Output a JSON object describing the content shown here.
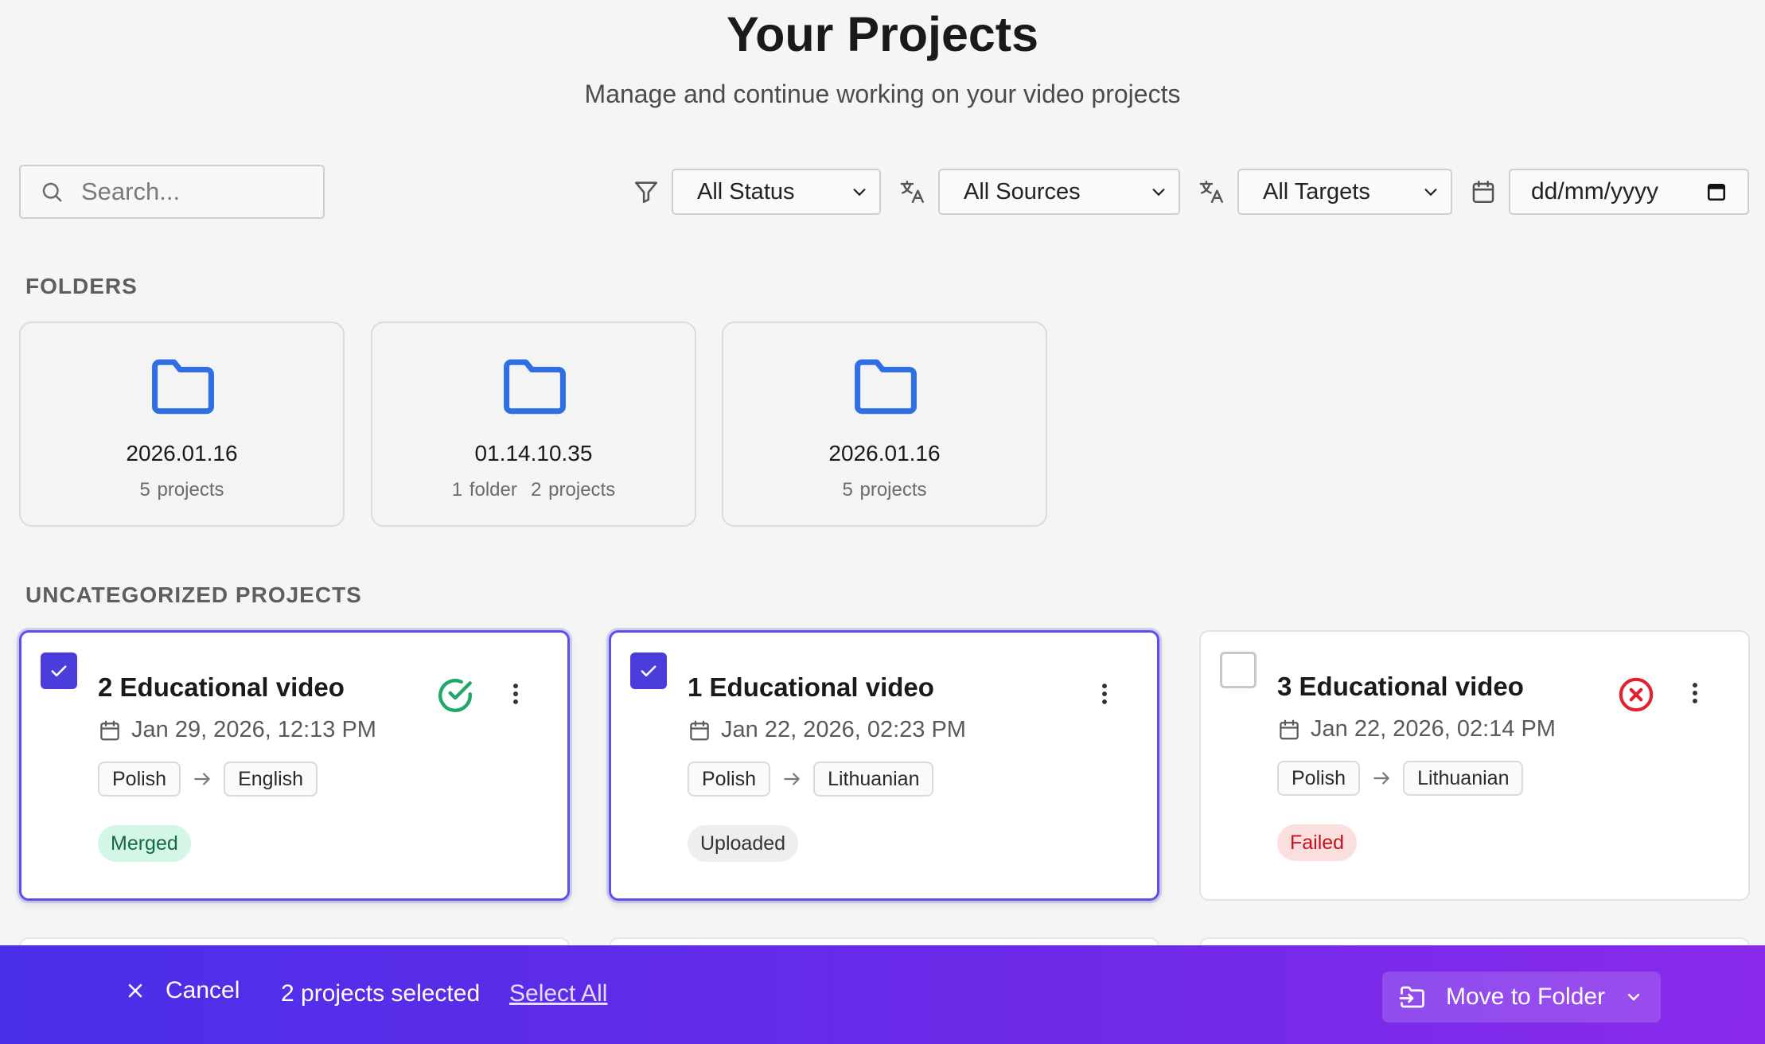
{
  "header": {
    "title": "Your Projects",
    "subtitle": "Manage and continue working on your video projects"
  },
  "search": {
    "placeholder": "Search..."
  },
  "filters": {
    "status": "All Status",
    "sources": "All Sources",
    "targets": "All Targets",
    "date_placeholder": "dd/mm/yyyy"
  },
  "folders_section": {
    "label": "FOLDERS",
    "items": [
      {
        "name": "2026.01.16",
        "meta": "5 projects"
      },
      {
        "name": "01.14.10.35",
        "meta": "1 folder  2 projects"
      },
      {
        "name": "2026.01.16",
        "meta": "5 projects"
      }
    ]
  },
  "projects_section": {
    "label": "UNCATEGORIZED PROJECTS",
    "items": [
      {
        "title": "2 Educational video",
        "date": "Jan 29, 2026, 12:13 PM",
        "source": "Polish",
        "target": "English",
        "status": "Merged",
        "selected": true,
        "status_icon": "check-circle-icon"
      },
      {
        "title": "1 Educational video",
        "date": "Jan 22, 2026, 02:23 PM",
        "source": "Polish",
        "target": "Lithuanian",
        "status": "Uploaded",
        "selected": true,
        "status_icon": ""
      },
      {
        "title": "3 Educational video",
        "date": "Jan 22, 2026, 02:14 PM",
        "source": "Polish",
        "target": "Lithuanian",
        "status": "Failed",
        "selected": false,
        "status_icon": "error-circle-icon"
      }
    ]
  },
  "action_bar": {
    "cancel_label": "Cancel",
    "selected_text": "2 projects selected",
    "select_all_label": "Select All",
    "move_label": "Move to Folder"
  },
  "colors": {
    "accent": "#4a3ddb",
    "folder_icon": "#2f6fe4",
    "merged": "#146a41",
    "failed": "#e0232e",
    "success_check": "#20a868"
  }
}
